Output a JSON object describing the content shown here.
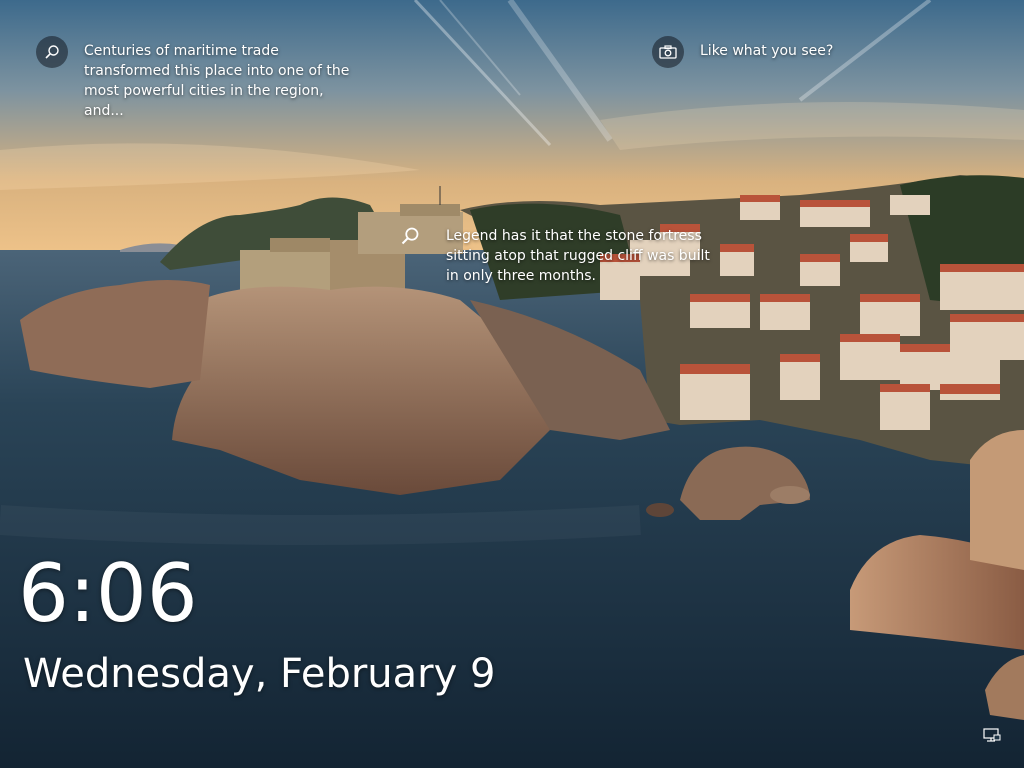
{
  "hints": [
    {
      "icon": "search-icon",
      "text": "Centuries of maritime trade transformed this place into one of the most powerful cities in the region, and..."
    },
    {
      "icon": "camera-icon",
      "text": "Like what you see?"
    },
    {
      "icon": "search-icon",
      "text": "Legend has it that the stone fortress sitting atop that rugged cliff was built in only three months."
    }
  ],
  "clock": {
    "time": "6:06",
    "date": "Wednesday, February 9"
  },
  "status": {
    "network_icon": "network-icon"
  },
  "colors": {
    "sky_top": "#3d6a8c",
    "sky_horizon": "#e8b77a",
    "sea": "#1d3446"
  }
}
